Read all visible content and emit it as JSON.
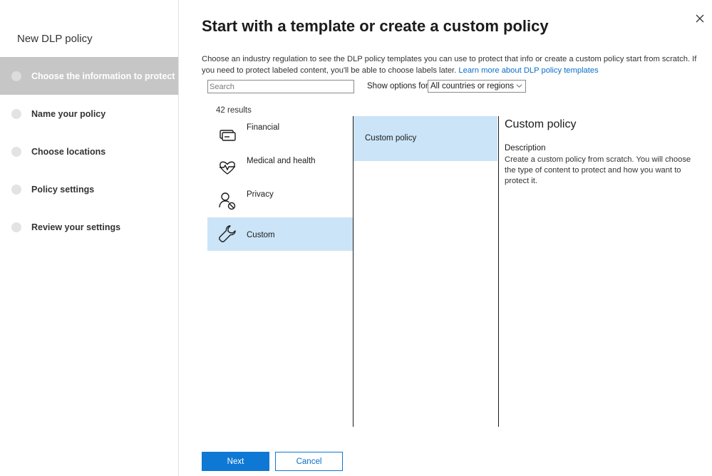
{
  "sidebar": {
    "title": "New DLP policy",
    "steps": [
      {
        "label": "Choose the information to protect",
        "active": true
      },
      {
        "label": "Name your policy"
      },
      {
        "label": "Choose locations"
      },
      {
        "label": "Policy settings"
      },
      {
        "label": "Review your settings"
      }
    ]
  },
  "main": {
    "heading": "Start with a template or create a custom policy",
    "description": "Choose an industry regulation to see the DLP policy templates you can use to protect that info or create a custom policy start from scratch. If you need to protect labeled content, you'll be able to choose labels later.",
    "learn_more": "Learn more about DLP policy templates",
    "search_placeholder": "Search",
    "show_options_label": "Show options for",
    "region_select": "All countries or regions",
    "results_count": "42 results",
    "categories": [
      {
        "label": "Financial",
        "icon": "credit-card-icon"
      },
      {
        "label": "Medical and health",
        "icon": "heart-pulse-icon"
      },
      {
        "label": "Privacy",
        "icon": "person-blocked-icon"
      },
      {
        "label": "Custom",
        "icon": "wrench-icon",
        "selected": true
      }
    ],
    "templates": [
      {
        "label": "Custom policy",
        "selected": true
      }
    ],
    "detail": {
      "title": "Custom policy",
      "description_label": "Description",
      "description": "Create a custom policy from scratch. You will choose the type of content to protect and how you want to protect it."
    },
    "buttons": {
      "next": "Next",
      "cancel": "Cancel"
    }
  },
  "colors": {
    "accent": "#0f78d4",
    "selection": "#cce4f7",
    "active_step": "#c6c6c6"
  }
}
